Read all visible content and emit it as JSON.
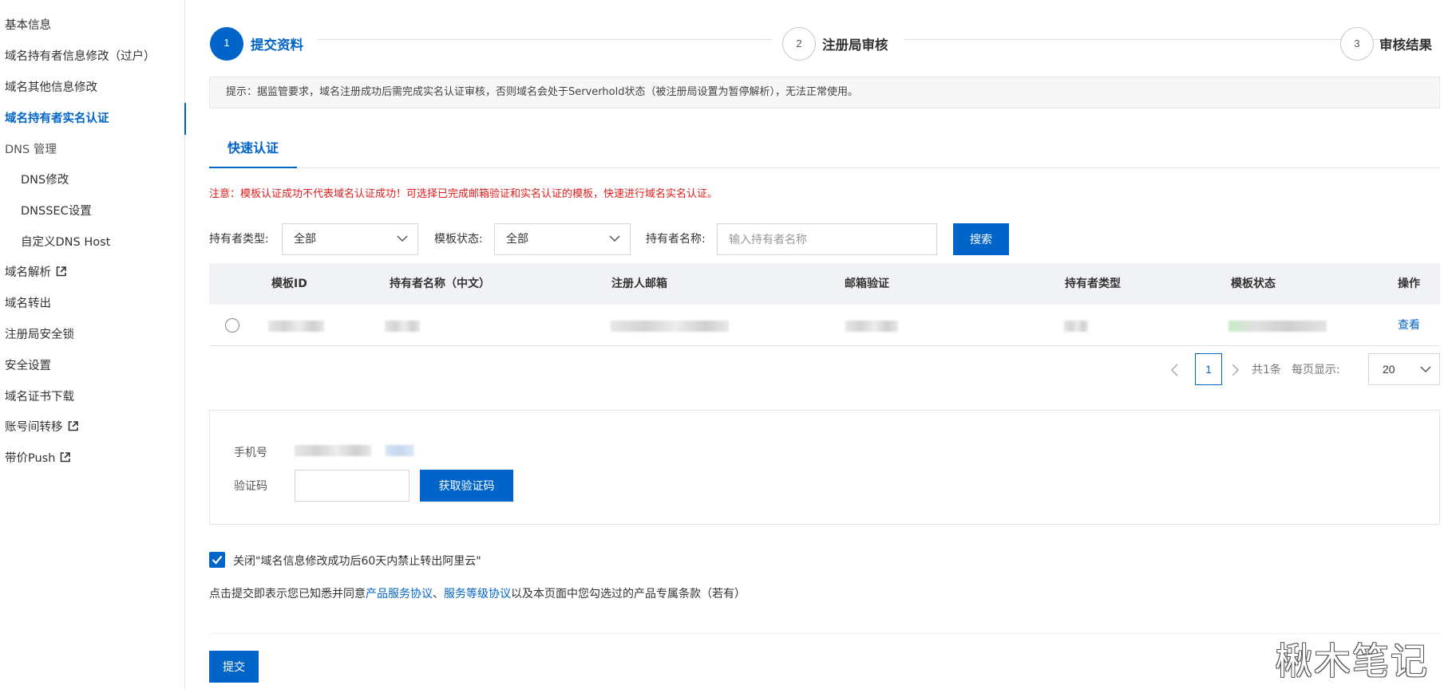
{
  "sidebar": {
    "items": [
      {
        "label": "基本信息"
      },
      {
        "label": "域名持有者信息修改（过户）"
      },
      {
        "label": "域名其他信息修改"
      },
      {
        "label": "域名持有者实名认证"
      },
      {
        "label": "DNS 管理"
      },
      {
        "label": "DNS修改"
      },
      {
        "label": "DNSSEC设置"
      },
      {
        "label": "自定义DNS Host"
      },
      {
        "label": "域名解析"
      },
      {
        "label": "域名转出"
      },
      {
        "label": "注册局安全锁"
      },
      {
        "label": "安全设置"
      },
      {
        "label": "域名证书下载"
      },
      {
        "label": "账号间转移"
      },
      {
        "label": "带价Push"
      }
    ],
    "active_index": 3
  },
  "steps": [
    {
      "number": "1",
      "label": "提交资料",
      "state": "active"
    },
    {
      "number": "2",
      "label": "注册局审核",
      "state": "pending"
    },
    {
      "number": "3",
      "label": "审核结果",
      "state": "pending"
    }
  ],
  "notice": "提示：据监管要求，域名注册成功后需完成实名认证审核，否则域名会处于Serverhold状态（被注册局设置为暂停解析），无法正常使用。",
  "tab": {
    "label": "快速认证"
  },
  "warning": "注意：模板认证成功不代表域名认证成功！可选择已完成邮箱验证和实名认证的模板，快速进行域名实名认证。",
  "filters": {
    "holder_type_label": "持有者类型:",
    "holder_type_value": "全部",
    "template_status_label": "模板状态:",
    "template_status_value": "全部",
    "holder_name_label": "持有者名称:",
    "holder_name_placeholder": "输入持有者名称",
    "search_button": "搜索"
  },
  "table": {
    "columns": [
      "模板ID",
      "持有者名称（中文）",
      "注册人邮箱",
      "邮箱验证",
      "持有者类型",
      "模板状态",
      "操作"
    ],
    "rows": [
      {
        "action": "查看"
      }
    ]
  },
  "pagination": {
    "current_page": "1",
    "total": "共1条",
    "page_size_label": "每页显示:",
    "page_size": "20"
  },
  "verification": {
    "phone_label": "手机号",
    "code_label": "验证码",
    "get_code_button": "获取验证码"
  },
  "checkbox": {
    "checked": true,
    "label": "关闭\"域名信息修改成功后60天内禁止转出阿里云\""
  },
  "agreement": {
    "prefix": "点击提交即表示您已知悉并同意",
    "link1": "产品服务协议",
    "sep": "、",
    "link2": "服务等级协议",
    "suffix": "以及本页面中您勾选过的产品专属条款（若有）"
  },
  "submit_button": "提交",
  "watermark": "楸木笔记",
  "colors": {
    "primary": "#0064c8",
    "warning": "#e01c1c",
    "table_header_bg": "#f0f2f5"
  }
}
